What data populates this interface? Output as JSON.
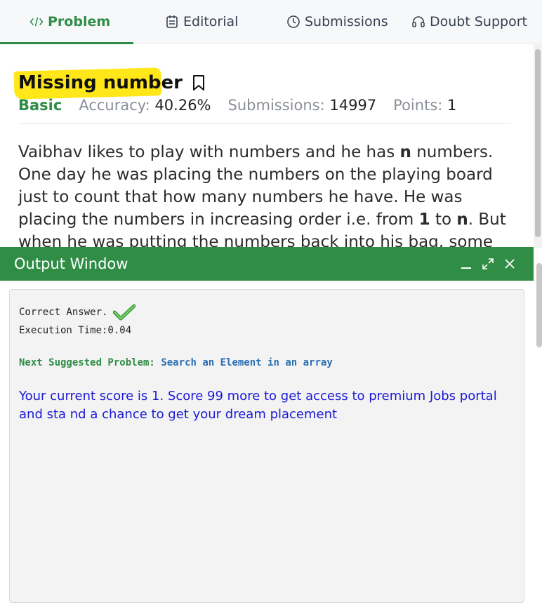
{
  "tabs": [
    {
      "label": "Problem",
      "icon": "code-icon"
    },
    {
      "label": "Editorial",
      "icon": "notes-icon"
    },
    {
      "label": "Submissions",
      "icon": "clock-icon"
    },
    {
      "label": "Doubt Support",
      "icon": "headset-icon"
    }
  ],
  "problem": {
    "title": "Missing number",
    "difficulty": "Basic",
    "accuracy_label": "Accuracy:",
    "accuracy_value": "40.26%",
    "submissions_label": "Submissions:",
    "submissions_value": "14997",
    "points_label": "Points:",
    "points_value": "1",
    "statement_parts": {
      "p1": "Vaibhav likes to play with numbers and he has ",
      "b1": "n",
      "p2": " numbers. One day he was placing the numbers on the playing board just to count that how many numbers he have. He was placing the numbers in increasing order i.e. from ",
      "b2": "1",
      "p3": " to ",
      "b3": "n",
      "p4": ". But when he was putting the numbers back into his bag, some numbers fell down"
    }
  },
  "output": {
    "title": "Output Window",
    "correct": "Correct Answer.",
    "exec_time": "Execution Time:0.04",
    "next_label": "Next Suggested Problem:",
    "next_link": "Search an Element in an array",
    "score_msg": "Your current score is 1. Score 99 more to get access to premium Jobs portal and sta nd a chance to get your dream placement"
  },
  "colors": {
    "accent": "#2f8d46",
    "link": "#2c6fb3",
    "score_text": "#1a1ad6",
    "highlight": "#ffe71a"
  }
}
